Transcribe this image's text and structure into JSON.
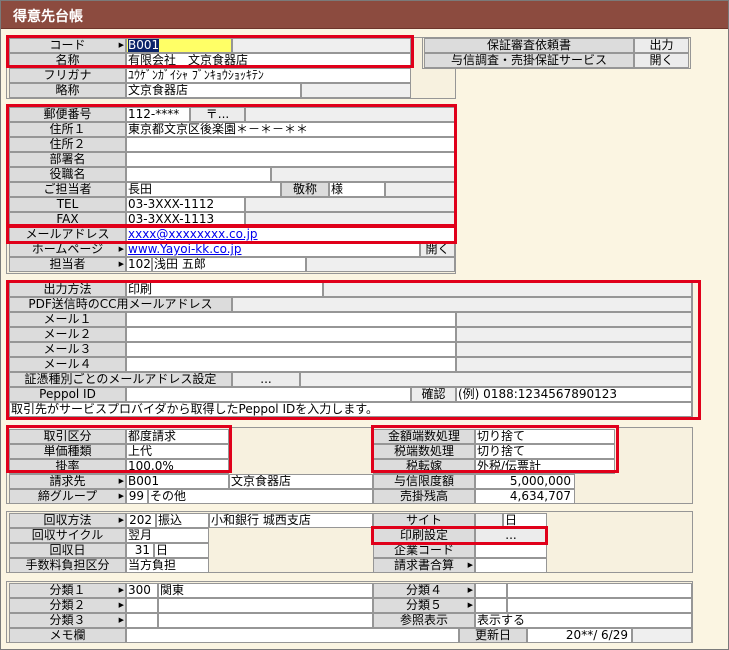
{
  "title": "得意先台帳",
  "code": {
    "label": "コード",
    "value": "B001"
  },
  "name": {
    "label": "名称",
    "value": "有限会社　文京食器店"
  },
  "furigana": {
    "label": "フリガナ",
    "value": "ﾕｳｹﾞﾝｶﾞｲｼｬ ﾌﾞﾝｷｮｳｼｮｯｷﾃﾝ"
  },
  "short_name": {
    "label": "略称",
    "value": "文京食器店"
  },
  "guarantee": {
    "label": "保証審査依頼書",
    "button": "出力"
  },
  "credit": {
    "label": "与信調査・売掛保証サービス",
    "button": "開く"
  },
  "postal": {
    "label": "郵便番号",
    "value": "112-****",
    "button": "〒..."
  },
  "address1": {
    "label": "住所１",
    "value": "東京都文京区後楽園＊－＊－＊＊"
  },
  "address2": {
    "label": "住所２",
    "value": ""
  },
  "department": {
    "label": "部署名",
    "value": ""
  },
  "position": {
    "label": "役職名",
    "value": ""
  },
  "contact": {
    "label": "ご担当者",
    "value": "長田",
    "honorific_label": "敬称",
    "honorific": "様"
  },
  "tel": {
    "label": "TEL",
    "value": "03-3XXX-1112"
  },
  "fax": {
    "label": "FAX",
    "value": "03-3XXX-1113"
  },
  "email": {
    "label": "メールアドレス",
    "value": "xxxx@xxxxxxxx.co.jp"
  },
  "homepage": {
    "label": "ホームページ",
    "value": "www.Yayoi-kk.co.jp",
    "button": "開く"
  },
  "staff": {
    "label": "担当者",
    "code": "102",
    "name": "浅田 五郎"
  },
  "output_method": {
    "label": "出力方法",
    "value": "印刷"
  },
  "pdf_cc": {
    "label": "PDF送信時のCC用メールアドレス"
  },
  "mails": [
    {
      "label": "メール１",
      "value": ""
    },
    {
      "label": "メール２",
      "value": ""
    },
    {
      "label": "メール３",
      "value": ""
    },
    {
      "label": "メール４",
      "value": ""
    }
  ],
  "voucher_mail": {
    "label": "証憑種別ごとのメールアドレス設定",
    "button": "..."
  },
  "peppol": {
    "label": "Peppol ID",
    "confirm": "確認",
    "example": "(例) 0188:1234567890123"
  },
  "peppol_note": "取引先がサービスプロバイダから取得したPeppol IDを入力します。",
  "trade_type": {
    "label": "取引区分",
    "value": "都度請求"
  },
  "price_type": {
    "label": "単価種類",
    "value": "上代"
  },
  "rate": {
    "label": "掛率",
    "value": "100.0%"
  },
  "amount_round": {
    "label": "金額端数処理",
    "value": "切り捨て"
  },
  "tax_round": {
    "label": "税端数処理",
    "value": "切り捨て"
  },
  "tax_transfer": {
    "label": "税転嫁",
    "value": "外税/伝票計"
  },
  "billing": {
    "label": "請求先",
    "code": "B001",
    "name": "文京食器店"
  },
  "closing": {
    "label": "締グループ",
    "code": "99",
    "name": "その他"
  },
  "credit_limit": {
    "label": "与信限度額",
    "value": "5,000,000"
  },
  "receivable": {
    "label": "売掛残高",
    "value": "4,634,707"
  },
  "collection_method": {
    "label": "回収方法",
    "code": "202",
    "type": "振込",
    "bank": "小和銀行 城西支店"
  },
  "collection_cycle": {
    "label": "回収サイクル",
    "value": "翌月"
  },
  "collection_day": {
    "label": "回収日",
    "day": "31",
    "unit": "日"
  },
  "fee": {
    "label": "手数料負担区分",
    "value": "当方負担"
  },
  "site": {
    "label": "サイト",
    "value": "日"
  },
  "print_settings": {
    "label": "印刷設定",
    "button": "..."
  },
  "company_code": {
    "label": "企業コード",
    "value": ""
  },
  "invoice_merge": {
    "label": "請求書合算",
    "value": ""
  },
  "class1": {
    "label": "分類１",
    "code": "300",
    "name": "関東"
  },
  "class2": {
    "label": "分類２",
    "value": ""
  },
  "class3": {
    "label": "分類３",
    "value": ""
  },
  "class4": {
    "label": "分類４",
    "value": ""
  },
  "class5": {
    "label": "分類５",
    "value": ""
  },
  "ref_display": {
    "label": "参照表示",
    "value": "表示する"
  },
  "memo": {
    "label": "メモ欄",
    "value": ""
  },
  "updated": {
    "label": "更新日",
    "value": "20**/ 6/29"
  },
  "colors": {
    "title_bar": "#8c4b3f",
    "highlight_frame": "#e0001a",
    "label_bg": "#dcdcdc",
    "form_bg": "#fbf5e2",
    "link": "#0000ee"
  }
}
